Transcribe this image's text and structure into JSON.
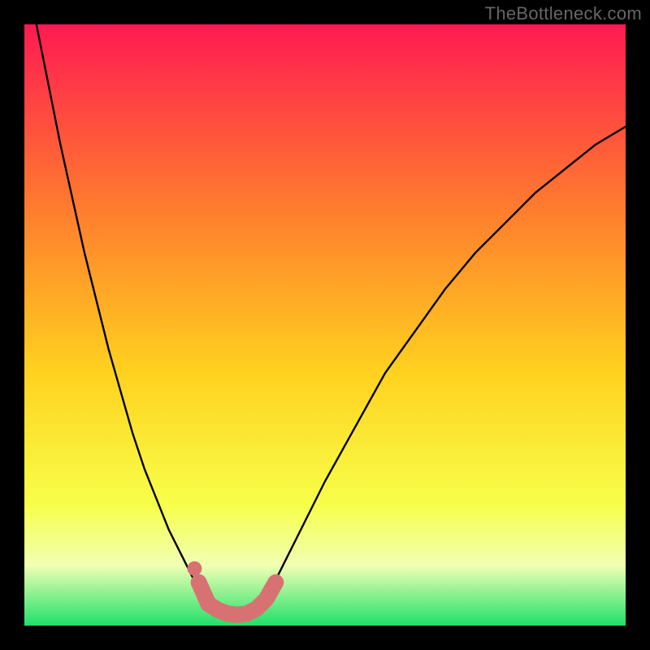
{
  "watermark": "TheBottleneck.com",
  "colors": {
    "black": "#000000",
    "grad_top": "#ff1a52",
    "grad_mid_upper": "#ff7a2e",
    "grad_mid": "#ffd21f",
    "grad_lower_yellow": "#f7ff4a",
    "grad_band_pale": "#f1ffb4",
    "grad_green": "#1fe06a",
    "curve": "#000000",
    "marker_fill": "#d87272",
    "marker_stroke": "#c55f5f"
  },
  "chart_data": {
    "type": "line",
    "title": "",
    "xlabel": "",
    "ylabel": "",
    "xlim": [
      0,
      1
    ],
    "ylim": [
      0,
      1
    ],
    "x": [
      0.0,
      0.02,
      0.04,
      0.06,
      0.08,
      0.1,
      0.12,
      0.14,
      0.16,
      0.18,
      0.2,
      0.22,
      0.24,
      0.26,
      0.28,
      0.3,
      0.32,
      0.34,
      0.36,
      0.38,
      0.4,
      0.42,
      0.44,
      0.46,
      0.48,
      0.5,
      0.55,
      0.6,
      0.65,
      0.7,
      0.75,
      0.8,
      0.85,
      0.9,
      0.95,
      1.0
    ],
    "series": [
      {
        "name": "bottleneck-curve",
        "values": [
          1.1,
          1.0,
          0.9,
          0.8,
          0.71,
          0.62,
          0.54,
          0.46,
          0.39,
          0.32,
          0.26,
          0.21,
          0.16,
          0.12,
          0.08,
          0.05,
          0.03,
          0.02,
          0.02,
          0.03,
          0.05,
          0.08,
          0.12,
          0.16,
          0.2,
          0.24,
          0.33,
          0.42,
          0.49,
          0.56,
          0.62,
          0.67,
          0.72,
          0.76,
          0.8,
          0.83
        ]
      }
    ],
    "markers": {
      "name": "highlight-markers",
      "points": [
        {
          "x": 0.29,
          "y": 0.072
        },
        {
          "x": 0.306,
          "y": 0.036
        },
        {
          "x": 0.322,
          "y": 0.026
        },
        {
          "x": 0.338,
          "y": 0.02
        },
        {
          "x": 0.354,
          "y": 0.018
        },
        {
          "x": 0.37,
          "y": 0.02
        },
        {
          "x": 0.386,
          "y": 0.028
        },
        {
          "x": 0.402,
          "y": 0.044
        },
        {
          "x": 0.418,
          "y": 0.072
        }
      ]
    },
    "background_gradient_stops": [
      {
        "offset": 0.0,
        "color": "#ff1a52"
      },
      {
        "offset": 0.3,
        "color": "#ff7a2e"
      },
      {
        "offset": 0.58,
        "color": "#ffd21f"
      },
      {
        "offset": 0.8,
        "color": "#f7ff4a"
      },
      {
        "offset": 0.9,
        "color": "#f1ffb4"
      },
      {
        "offset": 1.0,
        "color": "#1fe06a"
      }
    ]
  }
}
